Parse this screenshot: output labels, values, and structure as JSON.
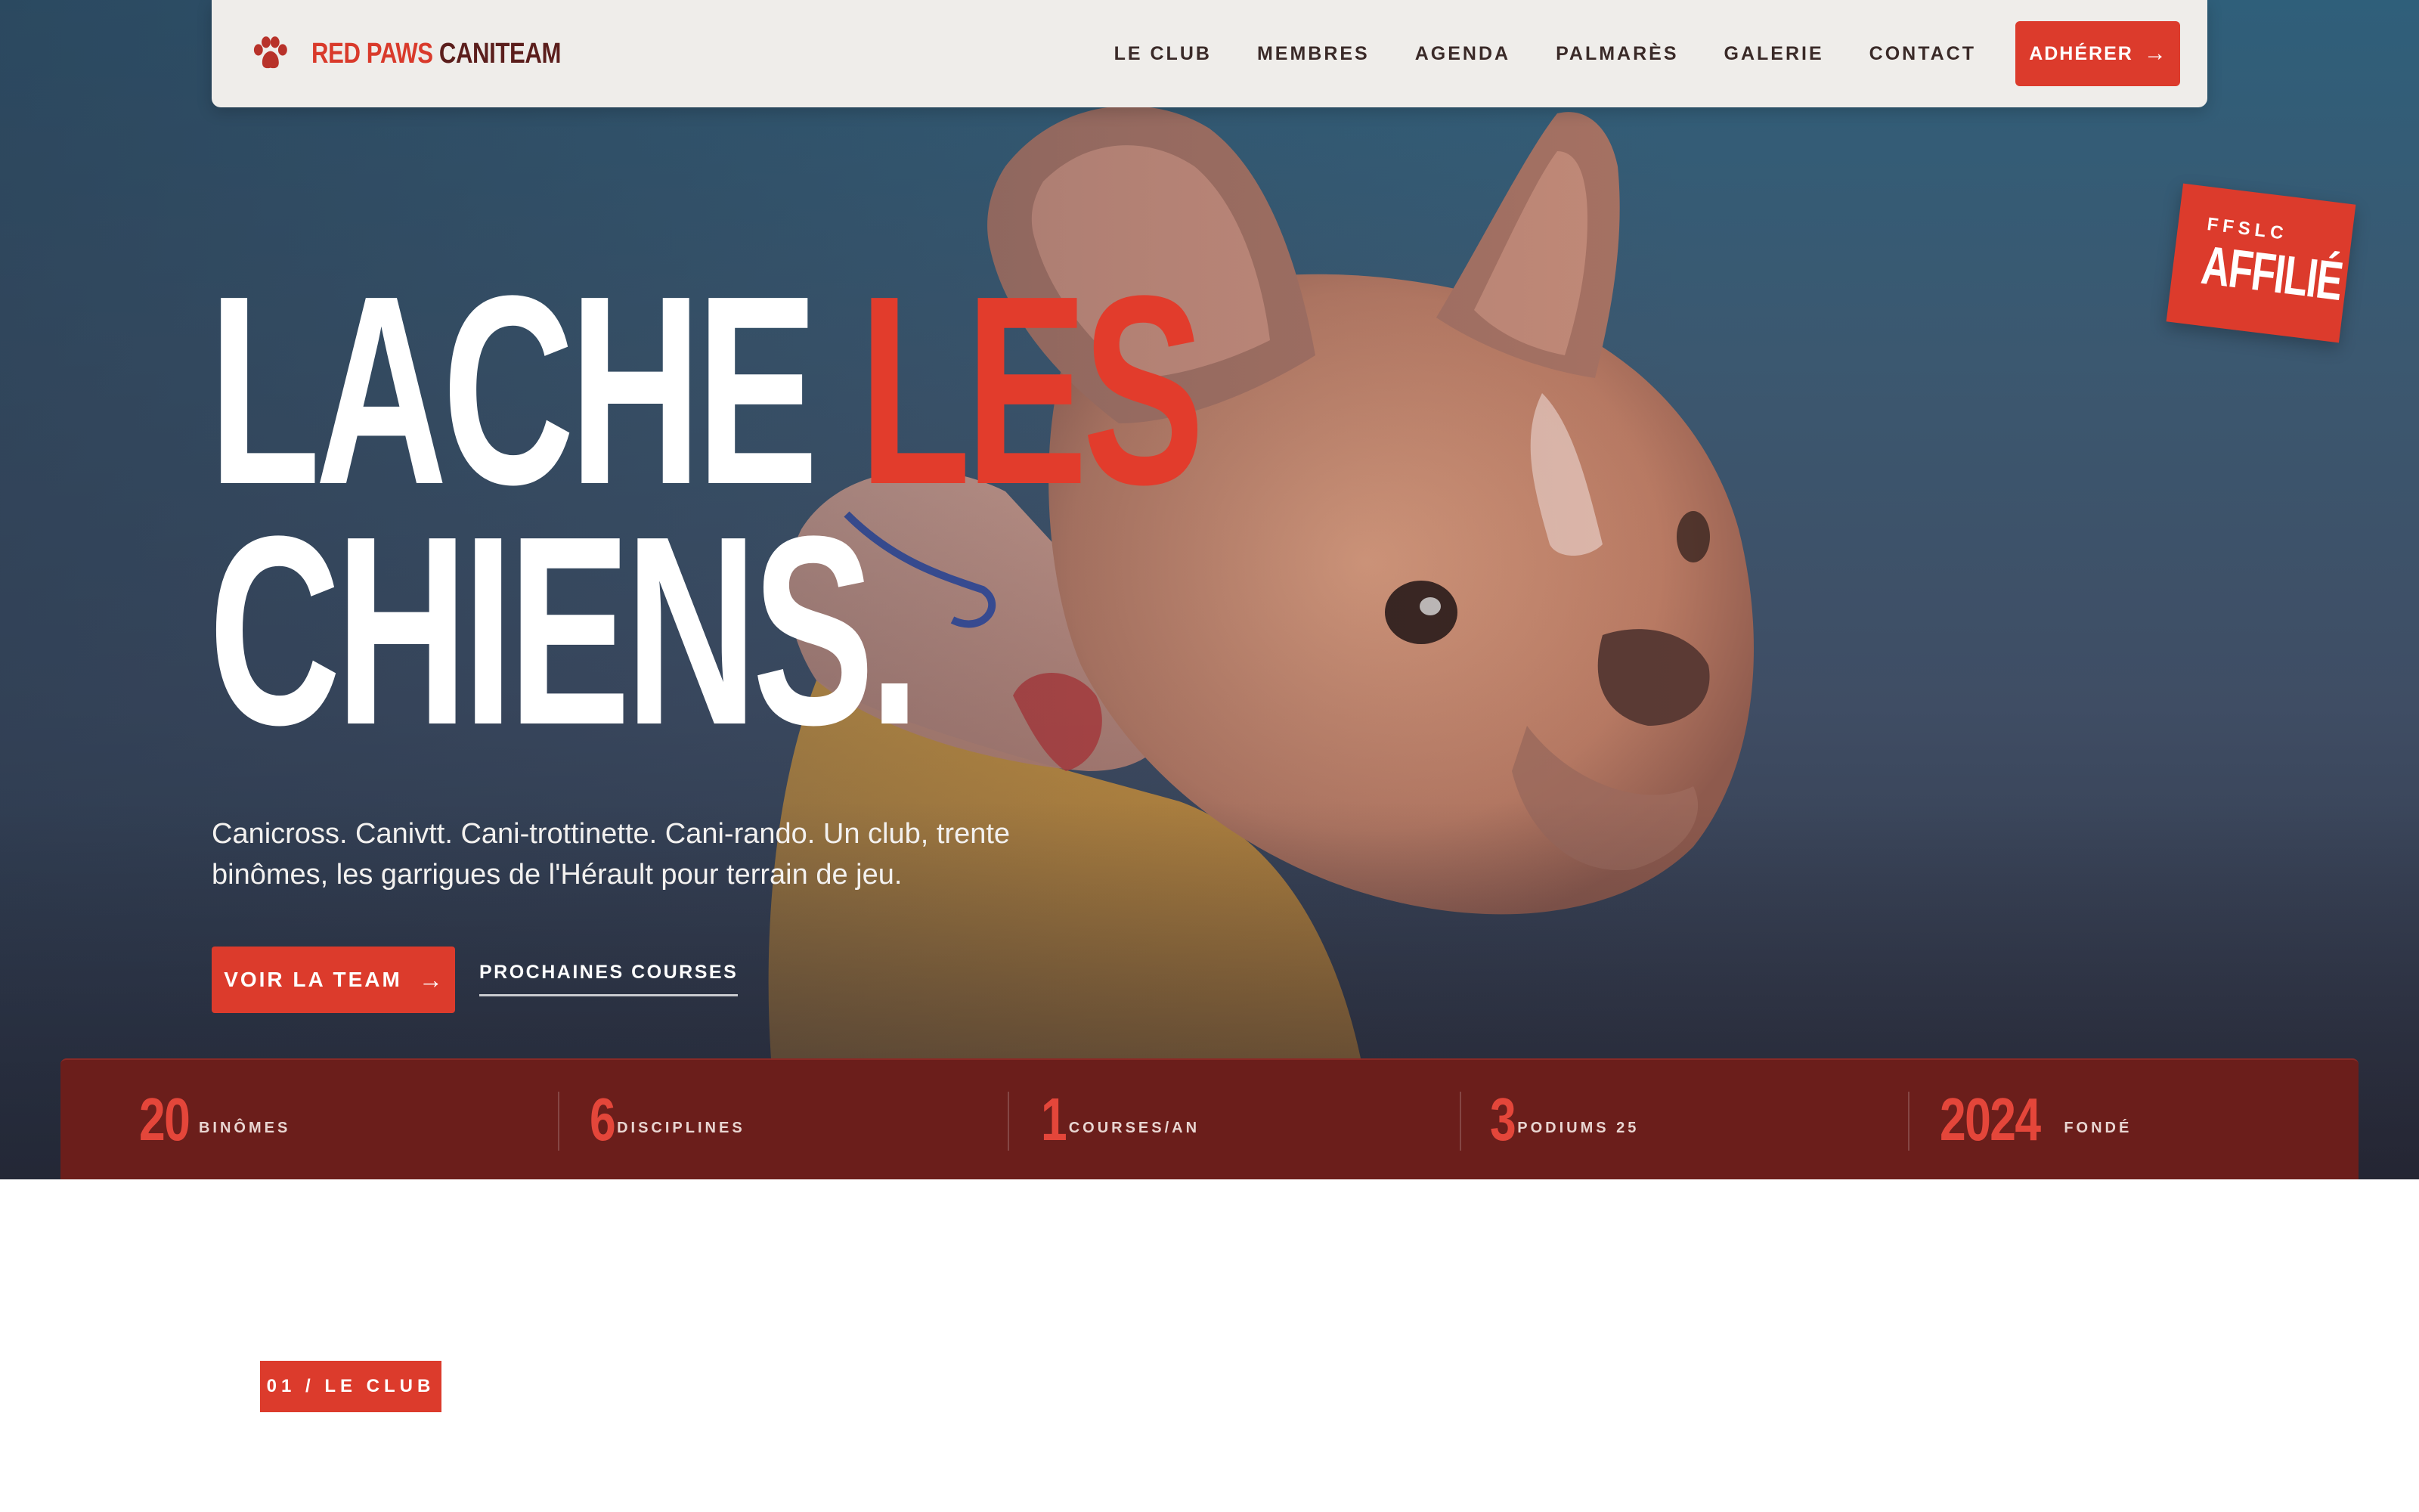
{
  "brand": {
    "name_part1": "RED PAWS",
    "name_part2": "CANITEAM",
    "icon": "paw-icon"
  },
  "nav": {
    "links": [
      "LE CLUB",
      "MEMBRES",
      "AGENDA",
      "PALMARÈS",
      "GALERIE",
      "CONTACT"
    ],
    "cta_label": "ADHÉRER",
    "cta_arrow": "→"
  },
  "hero": {
    "headline_line1_white": "LACHE",
    "headline_line1_red": "LES",
    "headline_line2": "CHIENS.",
    "lead": "Canicross. Canivtt. Cani-trottinette. Cani-rando. Un club, trente binômes, les garrigues de l'Hérault pour terrain de jeu.",
    "primary_label": "VOIR LA TEAM",
    "primary_arrow": "→",
    "secondary_label": "PROCHAINES COURSES"
  },
  "badge": {
    "small": "FFSLC",
    "big": "AFFILIÉ"
  },
  "stats": [
    {
      "value": "20",
      "label": "BINÔMES"
    },
    {
      "value": "6",
      "label": "DISCIPLINES"
    },
    {
      "value": "1",
      "label": "COURSES/AN"
    },
    {
      "value": "3",
      "label": "PODIUMS 25"
    },
    {
      "value": "2024",
      "label": "FONDÉ"
    }
  ],
  "section": {
    "tag": "01 / LE CLUB"
  },
  "colors": {
    "accent": "#dc3b2c",
    "stats_bg": "#6b1e1b",
    "nav_bg": "#efedea",
    "brand_dark": "#5b1e1c"
  }
}
